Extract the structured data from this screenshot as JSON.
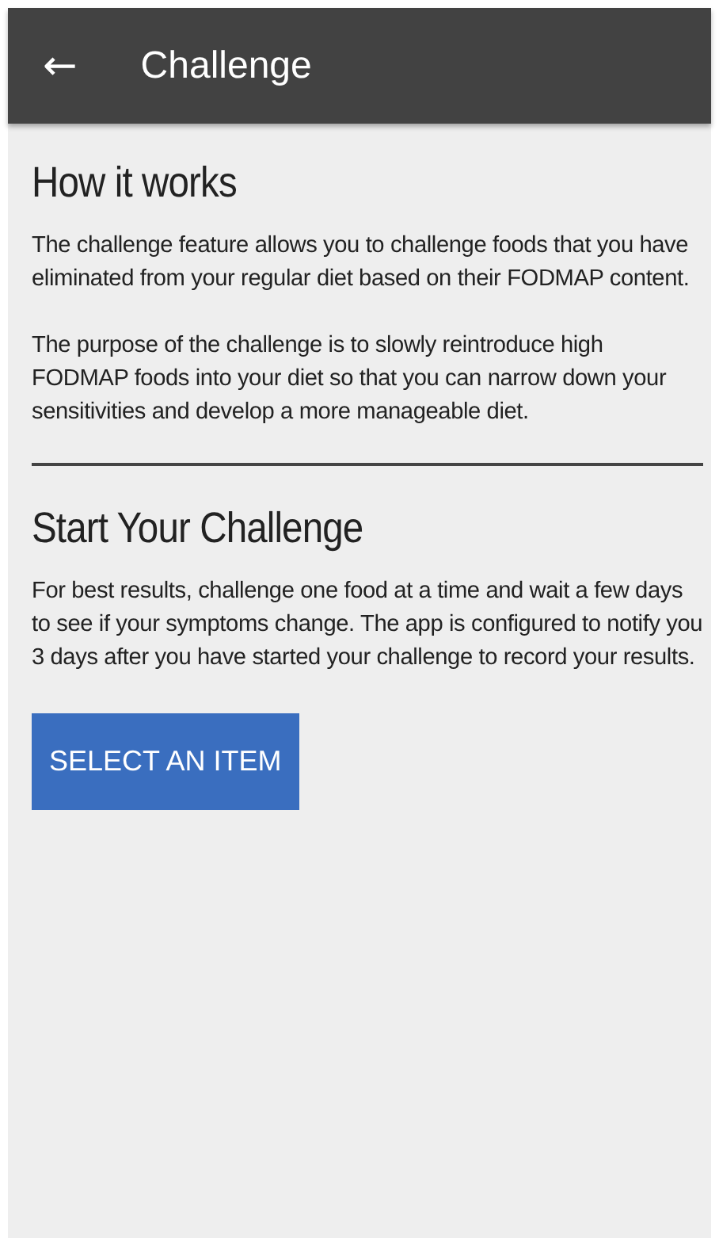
{
  "app_bar": {
    "back_icon": "←",
    "title": "Challenge"
  },
  "sections": [
    {
      "heading": "How it works",
      "paragraphs": [
        "The challenge feature allows you to challenge foods that you have eliminated from your regular diet based on their FODMAP content.",
        "The purpose of the challenge is to slowly reintroduce high FODMAP foods into your diet so that you can narrow down your sensitivities and develop a more manageable diet."
      ]
    },
    {
      "heading": "Start Your Challenge",
      "paragraphs": [
        "For best results, challenge one food at a time and wait a few days to see if your symptoms change. The app is configured to notify you 3 days after you have started your challenge to record your results."
      ],
      "button": "SELECT AN ITEM"
    }
  ]
}
